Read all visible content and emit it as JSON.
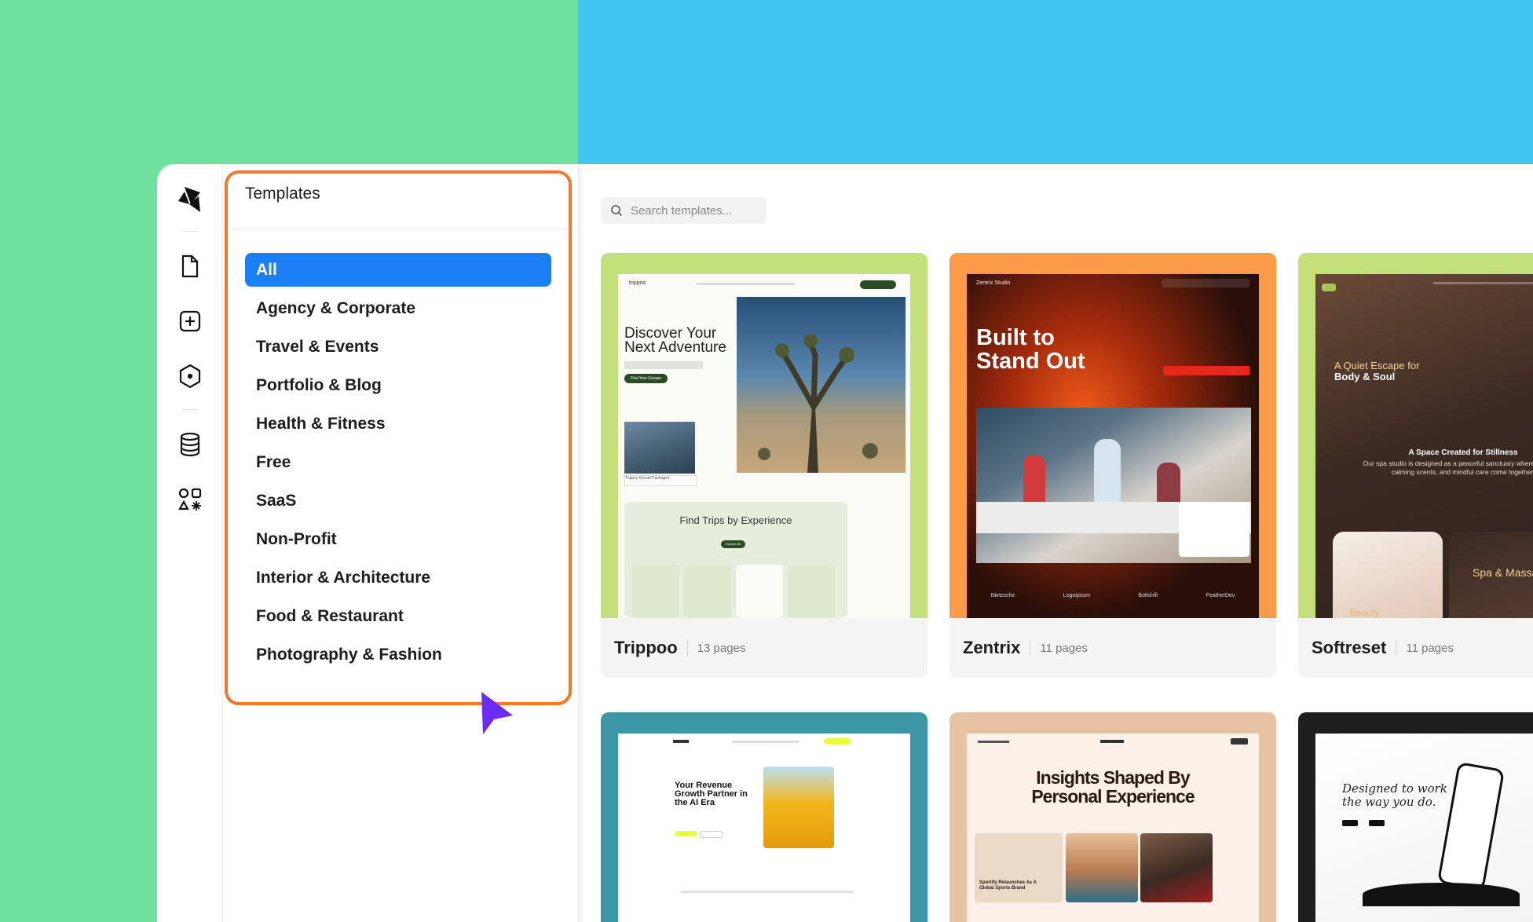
{
  "colors": {
    "left_background": "#6fe09e",
    "right_background": "#42c6f1",
    "accent": "#1a7ff5",
    "highlight": "#ef7a2d",
    "cursor": "#6a2cf0"
  },
  "rail": {
    "items": [
      {
        "icon": "logo-icon"
      },
      {
        "icon": "page-icon"
      },
      {
        "icon": "add-icon"
      },
      {
        "icon": "hexagon-icon"
      },
      {
        "icon": "database-icon"
      },
      {
        "icon": "shapes-icon"
      }
    ]
  },
  "panel": {
    "title": "Templates",
    "categories": [
      "All",
      "Agency & Corporate",
      "Travel & Events",
      "Portfolio & Blog",
      "Health & Fitness",
      "Free",
      "SaaS",
      "Non-Profit",
      "Interior & Architecture",
      "Food & Restaurant",
      "Photography & Fashion"
    ],
    "active_index": 0
  },
  "search": {
    "placeholder": "Search templates..."
  },
  "templates": [
    {
      "name": "Trippoo",
      "pages": "13 pages",
      "frame_color": "#c3e07a",
      "preview": {
        "logo": "trippoo",
        "heading_line1": "Discover Your",
        "heading_line2": "Next Adventure",
        "cta": "Find Your Escape",
        "caption": "Trippoo Ocean Packages",
        "section_title": "Find Trips by Experience",
        "section_cta": "Explore All"
      }
    },
    {
      "name": "Zentrix",
      "pages": "11 pages",
      "frame_color": "#fb9a47",
      "preview": {
        "logo": "Zentrix Studio",
        "heading_line1": "Built to",
        "heading_line2": "Stand Out",
        "brands": [
          "Nietzsche",
          "Logoipsum",
          "Boltshift",
          "FeatherDev"
        ]
      }
    },
    {
      "name": "Softreset",
      "pages": "11 pages",
      "frame_color": "#c3e07a",
      "preview": {
        "tagline_line1": "A Quiet Escape for",
        "tagline_line2": "Body & Soul",
        "section_title": "A Space Created for Stillness",
        "section_text": "Our spa studio is designed as a peaceful sanctuary where soft light, calming scents, and mindful care come together.",
        "label": "Spa & Massage",
        "label2": "Beauty"
      }
    },
    {
      "name": "",
      "pages": "",
      "frame_color": "#3b96a6",
      "preview": {
        "heading": "Your Revenue Growth Partner in the AI Era"
      }
    },
    {
      "name": "",
      "pages": "",
      "frame_color": "#e8c3a3",
      "preview": {
        "title": "Insights Shaped By Personal Experience",
        "article": "Sportify Relaunches As A Global Sports Brand"
      }
    },
    {
      "name": "",
      "pages": "",
      "frame_color": "#1e1e1e",
      "preview": {
        "heading_line1": "Designed to work",
        "heading_line2": "the way you do."
      }
    }
  ]
}
